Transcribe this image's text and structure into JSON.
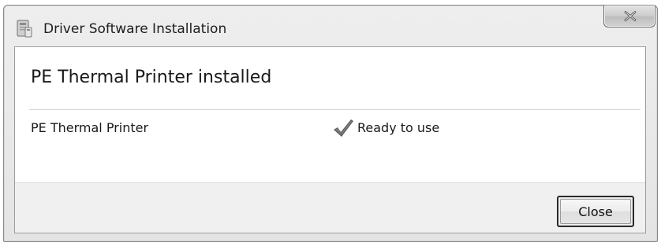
{
  "window": {
    "title": "Driver Software Installation",
    "close_icon": "close-icon",
    "app_icon": "driver-installer-icon"
  },
  "content": {
    "heading": "PE Thermal Printer installed",
    "devices": [
      {
        "name": "PE Thermal Printer",
        "status": "Ready to use",
        "status_icon": "checkmark-icon"
      }
    ]
  },
  "footer": {
    "close_label": "Close"
  }
}
